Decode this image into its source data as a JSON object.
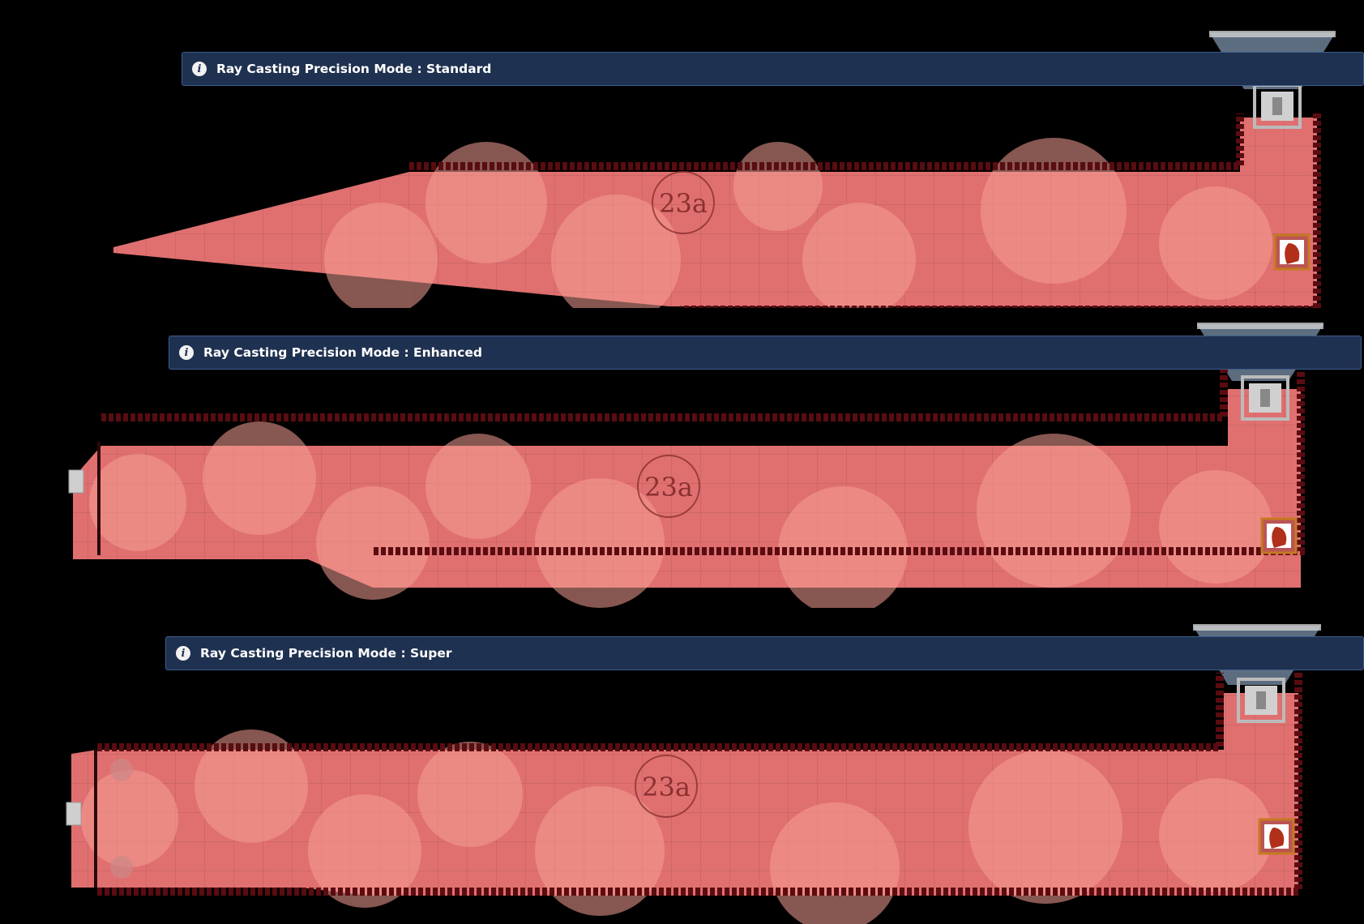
{
  "panels": [
    {
      "notice_text": "Ray Casting Precision Mode : Standard",
      "room_label": "23a"
    },
    {
      "notice_text": "Ray Casting Precision Mode : Enhanced",
      "room_label": "23a"
    },
    {
      "notice_text": "Ray Casting Precision Mode : Super",
      "room_label": "23a"
    }
  ],
  "icons": {
    "notice": "info-icon",
    "door": "door-icon",
    "token": "character-token-icon",
    "light": "light-cone"
  },
  "colors": {
    "notice_bg": "#1f3150",
    "notice_border": "#3c5d8a",
    "room_fill": "#e06a6a",
    "wall": "#5a0c10",
    "light_cone": "#a9c6ea",
    "background": "#000000"
  }
}
